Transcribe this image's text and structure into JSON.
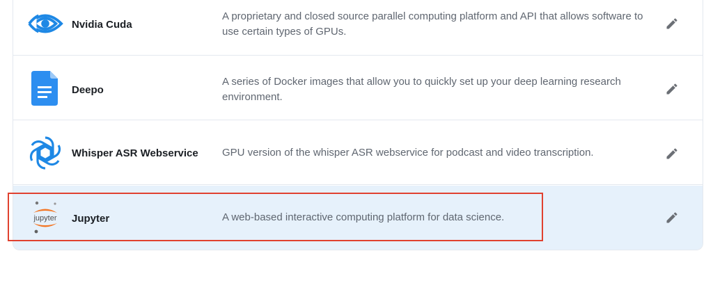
{
  "services": [
    {
      "name": "Nvidia Cuda",
      "icon": "nvidia-eye-icon",
      "description": "A proprietary and closed source parallel computing platform and API that allows software to use certain types of GPUs."
    },
    {
      "name": "Deepo",
      "icon": "document-icon",
      "description": "A series of Docker images that allow you to quickly set up your deep learning research environment."
    },
    {
      "name": "Whisper ASR Webservice",
      "icon": "openai-knot-icon",
      "description": "GPU version of the whisper ASR webservice for podcast and video transcription."
    },
    {
      "name": "Jupyter",
      "icon": "jupyter-logo-icon",
      "logo_text": "jupyter",
      "description": "A web-based interactive computing platform for data science."
    }
  ],
  "colors": {
    "selected_row_bg": "#e6f1fb",
    "highlight_border": "#e0412f",
    "icon_blue": "#1e88e5",
    "jupyter_orange": "#f37726",
    "edit_icon": "#6b6f75"
  },
  "edit_icon": "pencil-icon"
}
